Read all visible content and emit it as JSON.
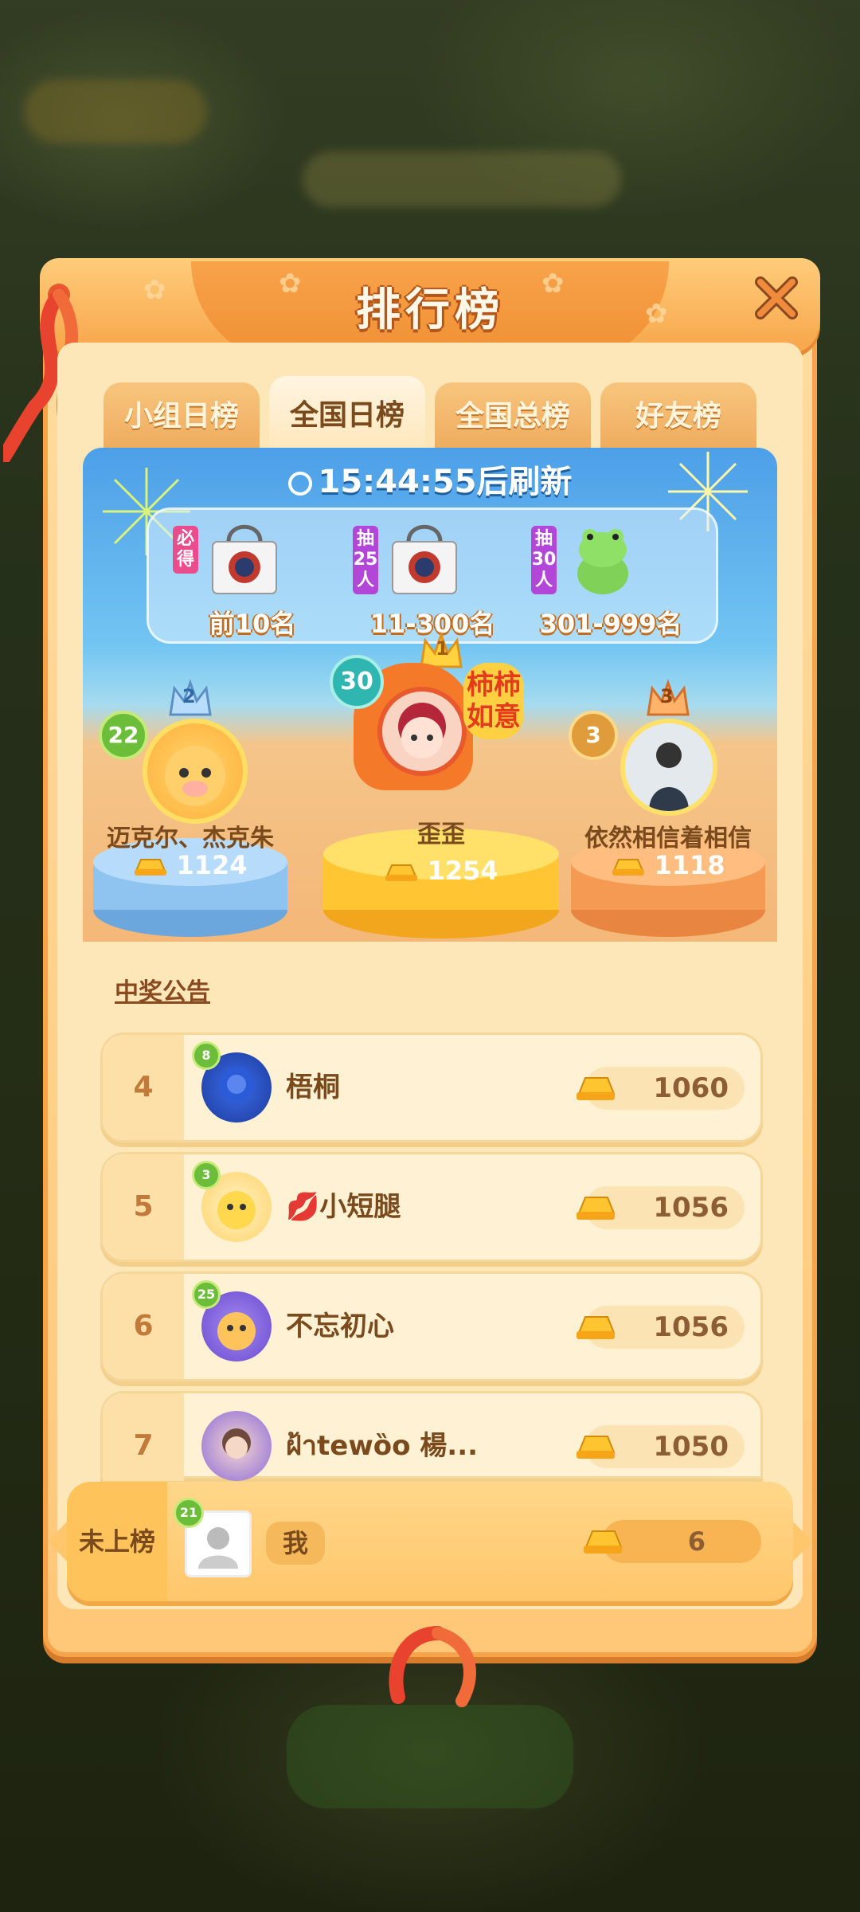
{
  "title": "排行榜",
  "tabs": [
    {
      "label": "小组日榜",
      "active": false
    },
    {
      "label": "全国日榜",
      "active": true
    },
    {
      "label": "全国总榜",
      "active": false
    },
    {
      "label": "好友榜",
      "active": false
    }
  ],
  "timer": "15:44:55后刷新",
  "prizes": [
    {
      "tag": "必得",
      "label": "前10名",
      "icon": "tote-bag-icon"
    },
    {
      "tag": "抽25人",
      "label": "11-300名",
      "icon": "tote-bag-icon"
    },
    {
      "tag": "抽30人",
      "label": "301-999名",
      "icon": "frog-plush-icon"
    }
  ],
  "podium": {
    "first": {
      "rank": "1",
      "level": "30",
      "name": "歪歪",
      "score": "1254",
      "badge": "柿柿如意"
    },
    "second": {
      "rank": "2",
      "level": "22",
      "name": "迈克尔、杰克朱",
      "score": "1124"
    },
    "third": {
      "rank": "3",
      "level": "3",
      "name": "依然相信着相信",
      "score": "1118"
    }
  },
  "notice": "中奖公告",
  "ranks": [
    {
      "rank": "4",
      "level": "8",
      "name": "梧桐",
      "score": "1060"
    },
    {
      "rank": "5",
      "level": "3",
      "name": "💋小短腿",
      "score": "1056"
    },
    {
      "rank": "6",
      "level": "25",
      "name": "不忘初心",
      "score": "1056"
    },
    {
      "rank": "7",
      "level": "",
      "name": "ฝ้าtewȍo 楊...",
      "score": "1050"
    }
  ],
  "me": {
    "status": "未上榜",
    "level": "21",
    "name": "我",
    "score": "6"
  },
  "colors": {
    "panel": "#ffc777",
    "accent": "#f7a54a",
    "level_badge": "#6cbe3a",
    "text_brown": "#7a4a1c"
  }
}
